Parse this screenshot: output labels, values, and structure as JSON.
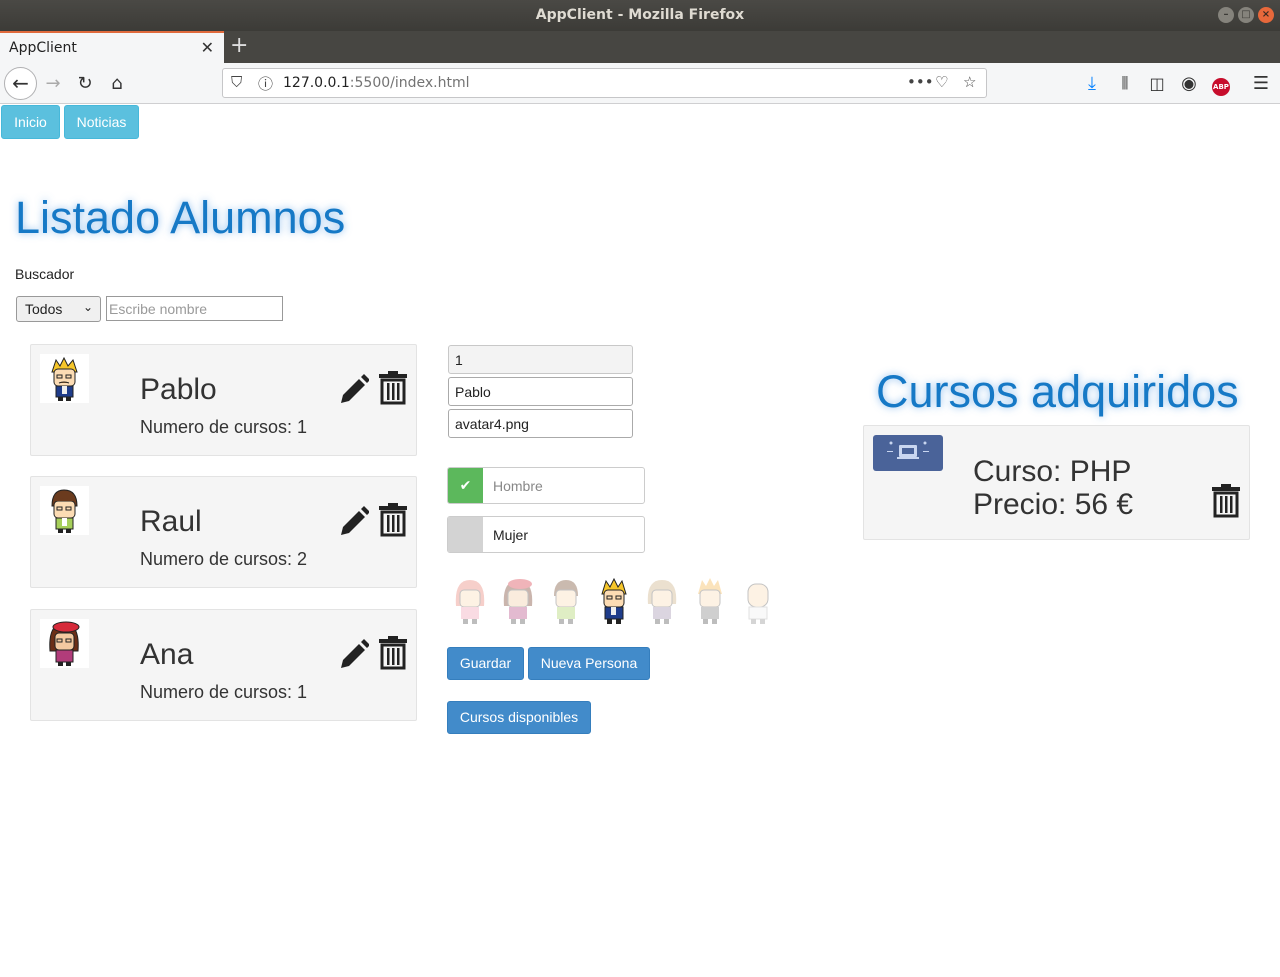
{
  "window": {
    "title": "AppClient - Mozilla Firefox"
  },
  "tab": {
    "title": "AppClient",
    "close": "✕"
  },
  "newtab": "+",
  "address": {
    "host": "127.0.0.1",
    "rest": ":5500/index.html"
  },
  "nav": {
    "inicio": "Inicio",
    "noticias": "Noticias"
  },
  "list": {
    "heading": "Listado Alumnos",
    "search_label": "Buscador",
    "filter_selected": "Todos",
    "search_placeholder": "Escribe nombre",
    "students": [
      {
        "name": "Pablo",
        "courses": "Numero de cursos: 1"
      },
      {
        "name": "Raul",
        "courses": "Numero de cursos: 2"
      },
      {
        "name": "Ana",
        "courses": "Numero de cursos: 1"
      }
    ]
  },
  "form": {
    "id_value": "1",
    "name_value": "Pablo",
    "avatar_value": "avatar4.png",
    "gender_male": "Hombre",
    "gender_female": "Mujer",
    "gender_check": "✔",
    "avatar_options": [
      "avatar1",
      "avatar2",
      "avatar3",
      "avatar4",
      "avatar5",
      "avatar6",
      "avatar7"
    ],
    "selected_avatar_index": 3,
    "save_label": "Guardar",
    "new_label": "Nueva Persona",
    "courses_label": "Cursos disponibles"
  },
  "acquired": {
    "heading": "Cursos adquiridos",
    "course_line": "Curso: PHP",
    "price_line": "Precio: 56 €"
  },
  "colors": {
    "accent_heading": "#1679c6",
    "btn_info": "#5bc0de",
    "btn_primary": "#428bca",
    "check_green": "#5cb85c"
  }
}
